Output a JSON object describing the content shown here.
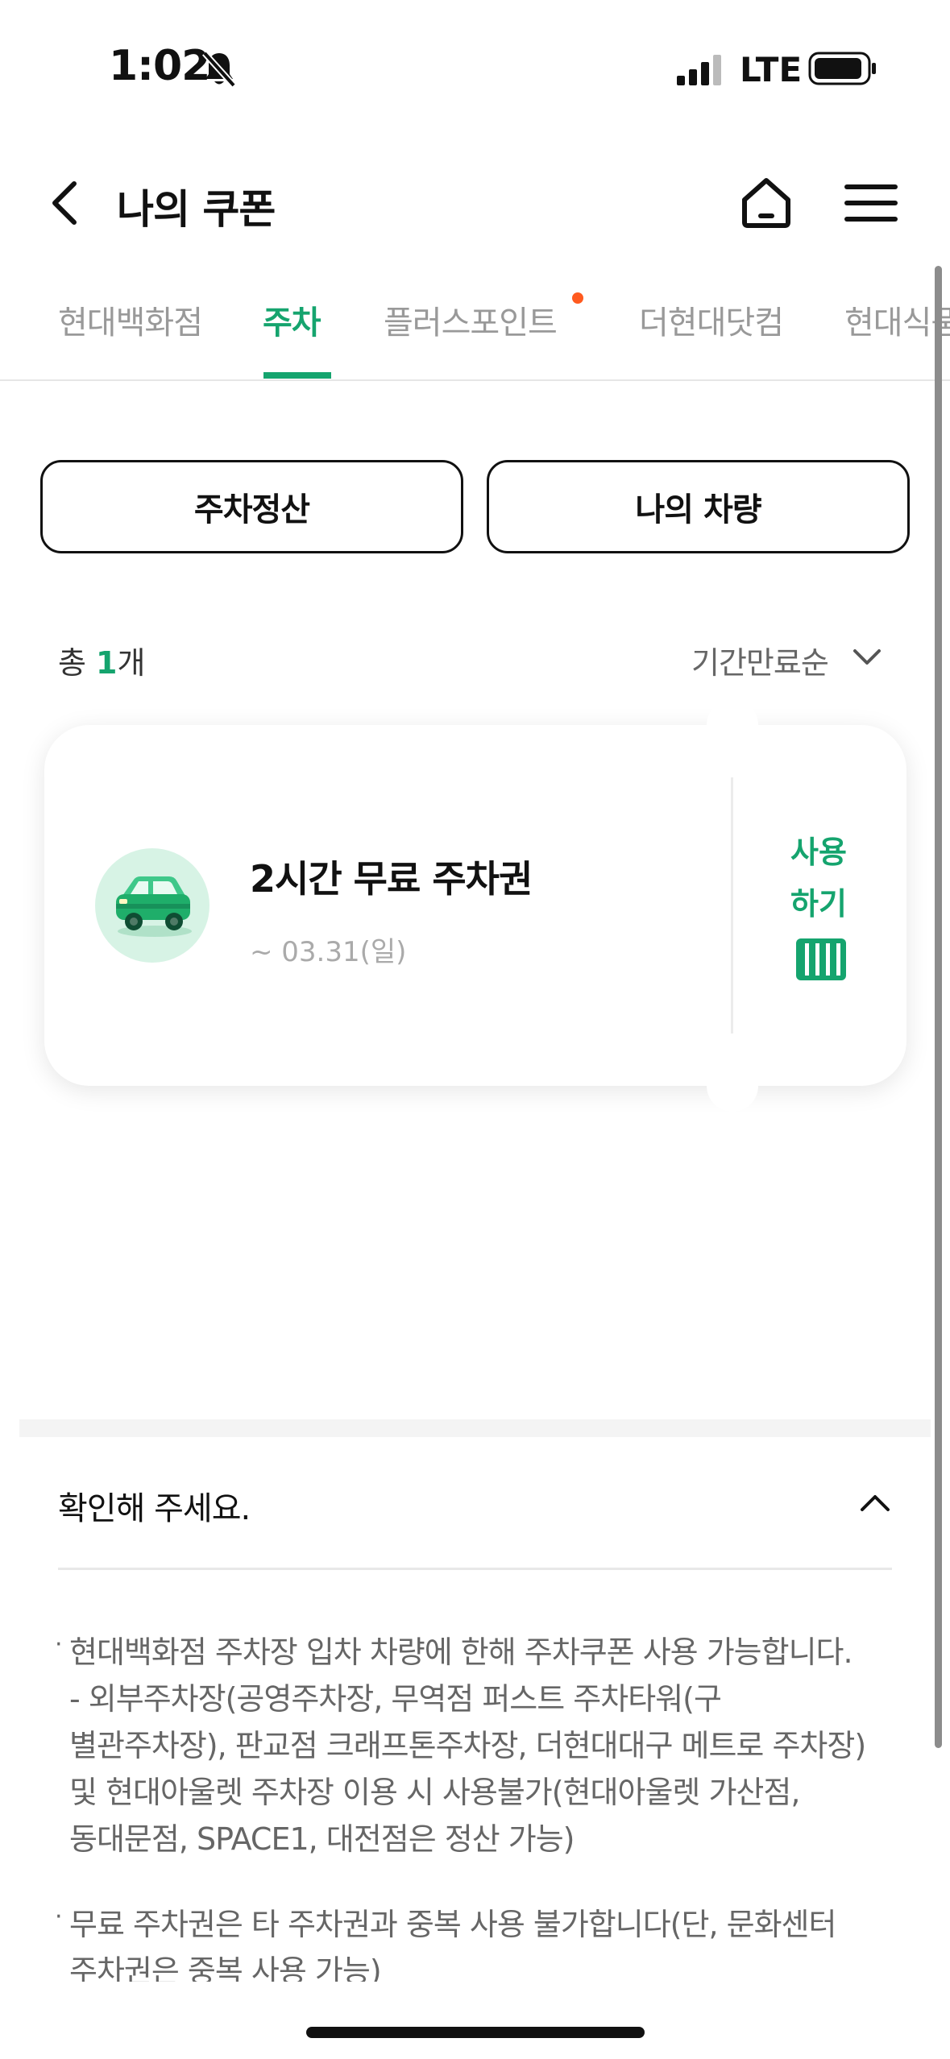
{
  "status_bar": {
    "time": "1:02",
    "network": "LTE"
  },
  "header": {
    "title": "나의 쿠폰",
    "icons": [
      "back-chevron-icon",
      "home-icon",
      "menu-icon"
    ]
  },
  "tabs": [
    {
      "label": "현대백화점",
      "active": false
    },
    {
      "label": "주차",
      "active": true
    },
    {
      "label": "플러스포인트",
      "active": false,
      "dot": true
    },
    {
      "label": "더현대닷컴",
      "active": false
    },
    {
      "label": "현대식품",
      "active": false
    }
  ],
  "actions": {
    "parking_payment": "주차정산",
    "my_vehicle": "나의 차량"
  },
  "list": {
    "count_prefix": "총 ",
    "count": "1",
    "count_suffix": "개",
    "sort_label": "기간만료순"
  },
  "coupon": {
    "title": "2시간 무료 주차권",
    "expiry": "~ 03.31(일)",
    "use_line1": "사용",
    "use_line2": "하기",
    "icon": "car-icon"
  },
  "notice": {
    "heading": "확인해 주세요.",
    "item1_lines": [
      "현대백화점 주차장 입차 차량에 한해 주차쿠폰 사용 가능합니다.",
      "- 외부주차장(공영주차장, 무역점 퍼스트 주차타워(구",
      "별관주차장), 판교점 크래프톤주차장, 더현대대구 메트로 주차장)",
      "및 현대아울렛 주차장 이용 시 사용불가(현대아울렛 가산점,",
      "동대문점, SPACE1, 대전점은 정산 가능)"
    ],
    "item2_lines": [
      "무료 주차권은 타 주차권과 중복 사용 불가합니다(단, 문화센터",
      "주차권은 중복 사용 가능)"
    ]
  },
  "colors": {
    "accent": "#15a46e",
    "dot": "#ff5a1f",
    "muted_text": "#999999"
  }
}
